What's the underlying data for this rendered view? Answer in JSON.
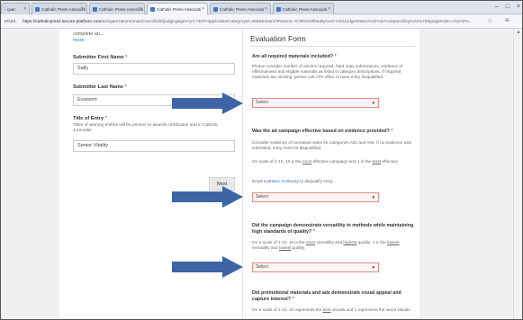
{
  "browser": {
    "tabs": [
      {
        "label": "- cpac"
      },
      {
        "label": "Catholic Press Associati"
      },
      {
        "label": "Catholic Press Associati"
      },
      {
        "label": "Catholic Press Associati"
      },
      {
        "label": "Catholic Press Associati"
      },
      {
        "label": "Catholic Press Associati"
      }
    ],
    "address_prefix": "ecure",
    "url_host": "https://catholicpress.secure-platform.com",
    "url_path": "/a/organizations/main/rounds/25/judgingagency/17403?applicationCategoryId=2668&searchParams=%7B%22filterBy%22:%22JudgeStatus%22%3A%22pending%22%7D&pageIndex=%3A0%..."
  },
  "left": {
    "truncated_text": "complete an...",
    "more_link": "more",
    "first_name_label": "Submitter First Name",
    "first_name_value": "Sally",
    "last_name_label": "Submitter Last Name",
    "last_name_value": "Evanson",
    "title_label": "Title of Entry",
    "title_help": "Titles of winning entries will be printed on awards certificates and in Catholic Journalist",
    "title_value": "Senior Vitality",
    "next_button": "Next",
    "required_mark": "*"
  },
  "eval": {
    "title": "Evaluation Form",
    "q1": "Are all required materials included?",
    "q1_text": "Please consider number of articles required, hard copy submissions, evidence of effectiveness and eligible materials as listed in category descriptions. If required materials are missing, please call CPA office to have entry disqualified.",
    "q2": "Was the ad campaign effective based on evidence provided?",
    "q2_text": "Consider evidence of increased sales for categories A01 and A06. If no evidence was submitted, entry must be disqualified.",
    "q2_scale_a": "On scale of 1-10, 10 is the ",
    "q2_scale_most": "most",
    "q2_scale_b": " effective campaign and 1 is the ",
    "q2_scale_least": "least",
    "q2_scale_c": " effective.",
    "email_prefix": "Email ",
    "email_name": "Kathleen Holloway",
    "email_suffix": " to disqualify entry.",
    "q3": "Did the campaign demonstrate versatility in methods while maintaining high standards of quality?",
    "q3_a": "On a scale of 1-10, 10 is the ",
    "q3_most": "most",
    "q3_b": " versatility and ",
    "q3_highest": "highest",
    "q3_c": " quality. 1 is the ",
    "q3_lowest": "lowest",
    "q3_d": " versatility and ",
    "q3_lowest2": "lowest",
    "q3_e": " quality.",
    "q4": "Did promotional materials and ads demonstrate visual appeal and capture interest?",
    "q4_a": "On a scale of 1-10, 10 represents the ",
    "q4_best": "best",
    "q4_b": " visuals and 1 represents the ",
    "q4_c": "worst visuals.",
    "select_placeholder": "Select",
    "required_mark": "*"
  },
  "colors": {
    "arrow": "#3f64a6",
    "required": "#e0504a",
    "link": "#3b6fb6"
  }
}
